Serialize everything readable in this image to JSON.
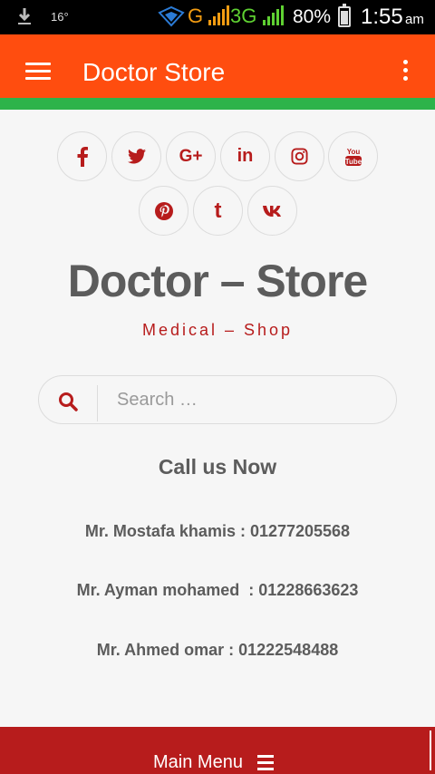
{
  "status_bar": {
    "temperature": "16°",
    "network_g": "G",
    "network_3g": "3G",
    "battery_percent": "80%",
    "battery_level": 0.8,
    "time": "1:55",
    "ampm": "am"
  },
  "app_bar": {
    "title": "Doctor Store",
    "menu_icon": "hamburger-icon",
    "overflow_icon": "more-vert-icon",
    "background": "#ff4d0f",
    "accent_strip": "#2db34a"
  },
  "social": [
    {
      "name": "facebook",
      "glyph": "f"
    },
    {
      "name": "twitter",
      "glyph": ""
    },
    {
      "name": "google-plus",
      "glyph": "G+"
    },
    {
      "name": "linkedin",
      "glyph": "in"
    },
    {
      "name": "instagram",
      "glyph": ""
    },
    {
      "name": "youtube",
      "glyph": ""
    },
    {
      "name": "pinterest",
      "glyph": ""
    },
    {
      "name": "tumblr",
      "glyph": "t"
    },
    {
      "name": "vk",
      "glyph": ""
    }
  ],
  "brand": {
    "name": "Doctor – Store",
    "tagline": "Medical – Shop"
  },
  "search": {
    "placeholder": "Search …",
    "value": ""
  },
  "contact": {
    "title": "Call us Now",
    "lines": [
      "Mr. Mostafa khamis : 01277205568",
      "Mr. Ayman mohamed  : 01228663623",
      "Mr. Ahmed omar : 01222548488"
    ]
  },
  "footer": {
    "main_menu_label": "Main Menu",
    "background": "#b71c1c"
  }
}
